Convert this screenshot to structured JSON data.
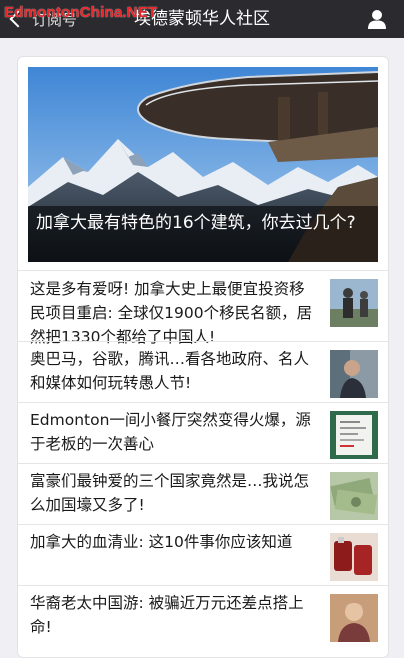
{
  "nav": {
    "back_label": "订阅号",
    "title": "埃德蒙顿华人社区"
  },
  "watermark": "EdmontonChina.NET",
  "featured": {
    "caption": "加拿大最有特色的16个建筑，你去过几个?"
  },
  "articles": [
    {
      "title": "这是多有爱呀! 加拿大史上最便宜投资移民项目重启: 全球仅1900个移民名额，居然把1330个都给了中国人!",
      "thumb": "people-outdoors"
    },
    {
      "title": "奥巴马，谷歌，腾讯…看各地政府、名人和媒体如何玩转愚人节!",
      "thumb": "person-portrait"
    },
    {
      "title": "Edmonton一间小餐厅突然变得火爆，源于老板的一次善心",
      "thumb": "restaurant-receipt"
    },
    {
      "title": "富豪们最钟爱的三个国家竟然是…我说怎么加国壕又多了!",
      "thumb": "money-bills"
    },
    {
      "title": "加拿大的血清业: 这10件事你应该知道",
      "thumb": "blood-bags"
    },
    {
      "title": "华裔老太中国游: 被骗近万元还差点搭上命!",
      "thumb": "elderly-woman"
    }
  ]
}
